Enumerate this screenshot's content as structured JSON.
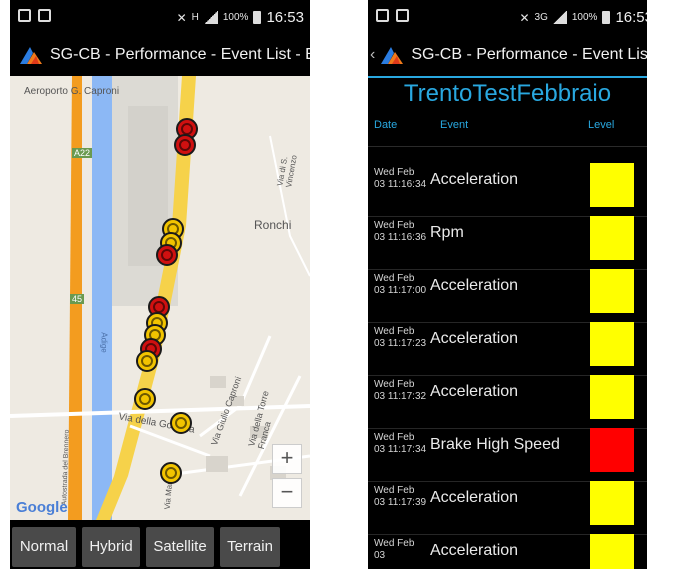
{
  "status_left": {
    "time": "16:53",
    "signal_text": "H",
    "battery_percent": "100%"
  },
  "status_right": {
    "time": "16:53",
    "network": "3G",
    "battery_percent": "100%"
  },
  "app_title_left": "SG-CB - Performance - Event List - E...",
  "app_title_right": "SG-CB - Performance - Event List - E...",
  "map": {
    "labels": {
      "airport": "Aeroporto G. Caproni",
      "road_a22": "A22",
      "ronchi": "Ronchi",
      "via_gotarda": "Via della Gotarda",
      "via_caproni": "Via Giulio Caproni",
      "via_torre": "Via della Torre Franca",
      "via_vincenzo": "Via di S. Vincenzo",
      "road_45": "45",
      "adige": "Adige",
      "via_marco": "Via Marconi",
      "autostrada": "Autostrada del Brennero"
    },
    "attribution": "Google",
    "zoom_in": "+",
    "zoom_out": "−",
    "map_types": [
      "Normal",
      "Hybrid",
      "Satellite",
      "Terrain"
    ],
    "marker_colors": {
      "yellow": "#f2c400",
      "red": "#d01010"
    }
  },
  "event_list": {
    "title": "TrentoTestFebbraio",
    "columns": {
      "date": "Date",
      "event": "Event",
      "level": "Level"
    },
    "rows": [
      {
        "date": "Wed Feb 03 11:16:34",
        "event": "Acceleration",
        "level_color": "#ffff00"
      },
      {
        "date": "Wed Feb 03 11:16:36",
        "event": "Rpm",
        "level_color": "#ffff00"
      },
      {
        "date": "Wed Feb 03 11:17:00",
        "event": "Acceleration",
        "level_color": "#ffff00"
      },
      {
        "date": "Wed Feb 03 11:17:23",
        "event": "Acceleration",
        "level_color": "#ffff00"
      },
      {
        "date": "Wed Feb 03 11:17:32",
        "event": "Acceleration",
        "level_color": "#ffff00"
      },
      {
        "date": "Wed Feb 03 11:17:34",
        "event": "Brake High Speed",
        "level_color": "#ff0000"
      },
      {
        "date": "Wed Feb 03 11:17:39",
        "event": "Acceleration",
        "level_color": "#ffff00"
      },
      {
        "date": "Wed Feb 03",
        "event": "Acceleration",
        "level_color": "#ffff00"
      }
    ]
  },
  "colors": {
    "accent": "#29a8e0",
    "background": "#000000",
    "road_orange": "#f39c1f",
    "road_yellow": "#f6d24a",
    "river": "#8cb8f5"
  }
}
